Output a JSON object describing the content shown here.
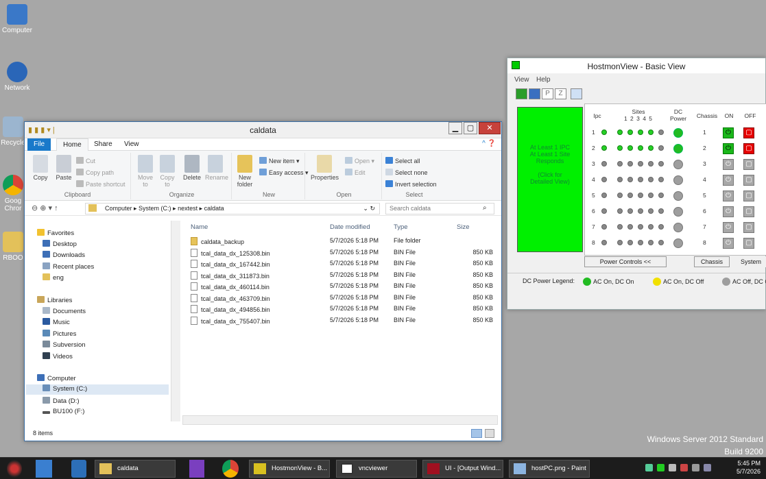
{
  "desktop": {
    "icons": [
      {
        "label": "Computer"
      },
      {
        "label": "Network"
      },
      {
        "label": "Recycle"
      },
      {
        "label": "Goog Chror"
      },
      {
        "label": "RBOO"
      }
    ],
    "watermark": {
      "line1": "Windows Server 2012 Standard",
      "line2": "Build 9200"
    }
  },
  "explorer": {
    "title": "caldata",
    "tabs": [
      "File",
      "Home",
      "Share",
      "View"
    ],
    "ribbon": {
      "clipboard": {
        "copy": "Copy",
        "paste": "Paste",
        "cut": "Cut",
        "copy_path": "Copy path",
        "paste_shortcut": "Paste shortcut",
        "label": "Clipboard"
      },
      "organize": {
        "move_to": "Move to",
        "copy_to": "Copy to",
        "delete": "Delete",
        "rename": "Rename",
        "label": "Organize"
      },
      "new": {
        "new_folder": "New folder",
        "new_item": "New item",
        "easy_access": "Easy access",
        "label": "New"
      },
      "open": {
        "properties": "Properties",
        "open": "Open",
        "edit": "Edit",
        "label": "Open"
      },
      "select": {
        "select_all": "Select all",
        "select_none": "Select none",
        "invert": "Invert selection",
        "label": "Select"
      }
    },
    "address": {
      "crumbs": [
        "Computer",
        "System (C:)",
        "nextest",
        "caldata"
      ],
      "search_placeholder": "Search caldata"
    },
    "nav": {
      "favorites": "Favorites",
      "fav_items": [
        "Desktop",
        "Downloads",
        "Recent places",
        "eng"
      ],
      "libraries": "Libraries",
      "lib_items": [
        "Documents",
        "Music",
        "Pictures",
        "Subversion",
        "Videos"
      ],
      "computer": "Computer",
      "drives": [
        "System (C:)",
        "Data (D:)",
        "BU100 (F:)"
      ]
    },
    "columns": [
      "Name",
      "Date modified",
      "Type",
      "Size"
    ],
    "files": [
      {
        "name": "caldata_backup",
        "date": "5/7/2026 5:18 PM",
        "type": "File folder",
        "size": ""
      },
      {
        "name": "tcal_data_dx_125308.bin",
        "date": "5/7/2026 5:18 PM",
        "type": "BIN File",
        "size": "850 KB"
      },
      {
        "name": "tcal_data_dx_167442.bin",
        "date": "5/7/2026 5:18 PM",
        "type": "BIN File",
        "size": "850 KB"
      },
      {
        "name": "tcal_data_dx_311873.bin",
        "date": "5/7/2026 5:18 PM",
        "type": "BIN File",
        "size": "850 KB"
      },
      {
        "name": "tcal_data_dx_460114.bin",
        "date": "5/7/2026 5:18 PM",
        "type": "BIN File",
        "size": "850 KB"
      },
      {
        "name": "tcal_data_dx_463709.bin",
        "date": "5/7/2026 5:18 PM",
        "type": "BIN File",
        "size": "850 KB"
      },
      {
        "name": "tcal_data_dx_494856.bin",
        "date": "5/7/2026 5:18 PM",
        "type": "BIN File",
        "size": "850 KB"
      },
      {
        "name": "tcal_data_dx_755407.bin",
        "date": "5/7/2026 5:18 PM",
        "type": "BIN File",
        "size": "850 KB"
      }
    ],
    "status": "8 items"
  },
  "hostmon": {
    "title": "HostmonView - Basic View",
    "menu": [
      "View",
      "Help"
    ],
    "toolbar": [
      "P",
      "Z"
    ],
    "panel": {
      "line1": "At Least 1 IPC",
      "line2": "At Least 1 Site",
      "line3": "Responds",
      "line4": "(Click for",
      "line5": "Detailed View)"
    },
    "headers": {
      "ipc": "Ipc",
      "sites": "Sites",
      "site_nums": "1  2  3  4  5",
      "dc1": "DC",
      "dc2": "Power",
      "chassis": "Chassis",
      "on": "ON",
      "off": "OFF"
    },
    "rows": [
      "1",
      "2",
      "3",
      "4",
      "5",
      "6",
      "7",
      "8"
    ],
    "buttons": {
      "power_controls": "Power Controls  <<",
      "chassis": "Chassis",
      "system": "System"
    },
    "legend": {
      "label": "DC Power Legend:",
      "a": "AC On, DC On",
      "b": "AC On, DC Off",
      "c": "AC Off, DC O"
    }
  },
  "taskbar": {
    "windows": [
      "caldata",
      "HostmonView - B...",
      "vncviewer",
      "UI - [Output Wind...",
      "hostPC.png - Paint"
    ],
    "time": "5:45 PM",
    "date": "5/7/2026"
  }
}
